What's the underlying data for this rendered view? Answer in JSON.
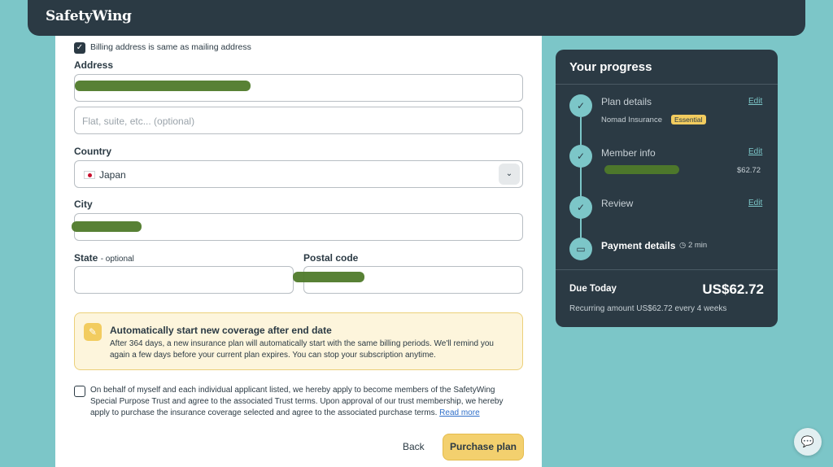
{
  "header": {
    "logo": "SafetyWing"
  },
  "form": {
    "billing_same_label": "Billing address is same as mailing address",
    "address_label": "Address",
    "address2_placeholder": "Flat, suite, etc... (optional)",
    "country_label": "Country",
    "country_value": "Japan",
    "city_label": "City",
    "state_label": "State",
    "state_optional": "- optional",
    "postal_label": "Postal code",
    "notice_title": "Automatically start new coverage after end date",
    "notice_body_1": "After 364 days, a new insurance plan will automatically start with the same billing periods. We'll remind you",
    "notice_body_2": "again a few days before your current plan expires. You can stop your subscription anytime.",
    "terms_1": "On behalf of myself and each individual applicant listed, we hereby apply to become members of the SafetyWing",
    "terms_2": "Special Purpose Trust and agree to the associated Trust terms. Upon approval of our trust membership, we hereby",
    "terms_3": "apply to purchase the insurance coverage selected and agree to the associated purchase terms.",
    "read_more": "Read more",
    "back_label": "Back",
    "purchase_label": "Purchase plan"
  },
  "progress": {
    "title": "Your progress",
    "steps": [
      {
        "title": "Plan details",
        "edit": "Edit",
        "sub": "Nomad Insurance",
        "badge": "Essential"
      },
      {
        "title": "Member info",
        "edit": "Edit",
        "amount": "$62.72"
      },
      {
        "title": "Review",
        "edit": "Edit"
      },
      {
        "title": "Payment details",
        "time": "2 min"
      }
    ],
    "due_label": "Due Today",
    "due_amount": "US$62.72",
    "recurring": "Recurring amount US$62.72 every 4 weeks"
  }
}
